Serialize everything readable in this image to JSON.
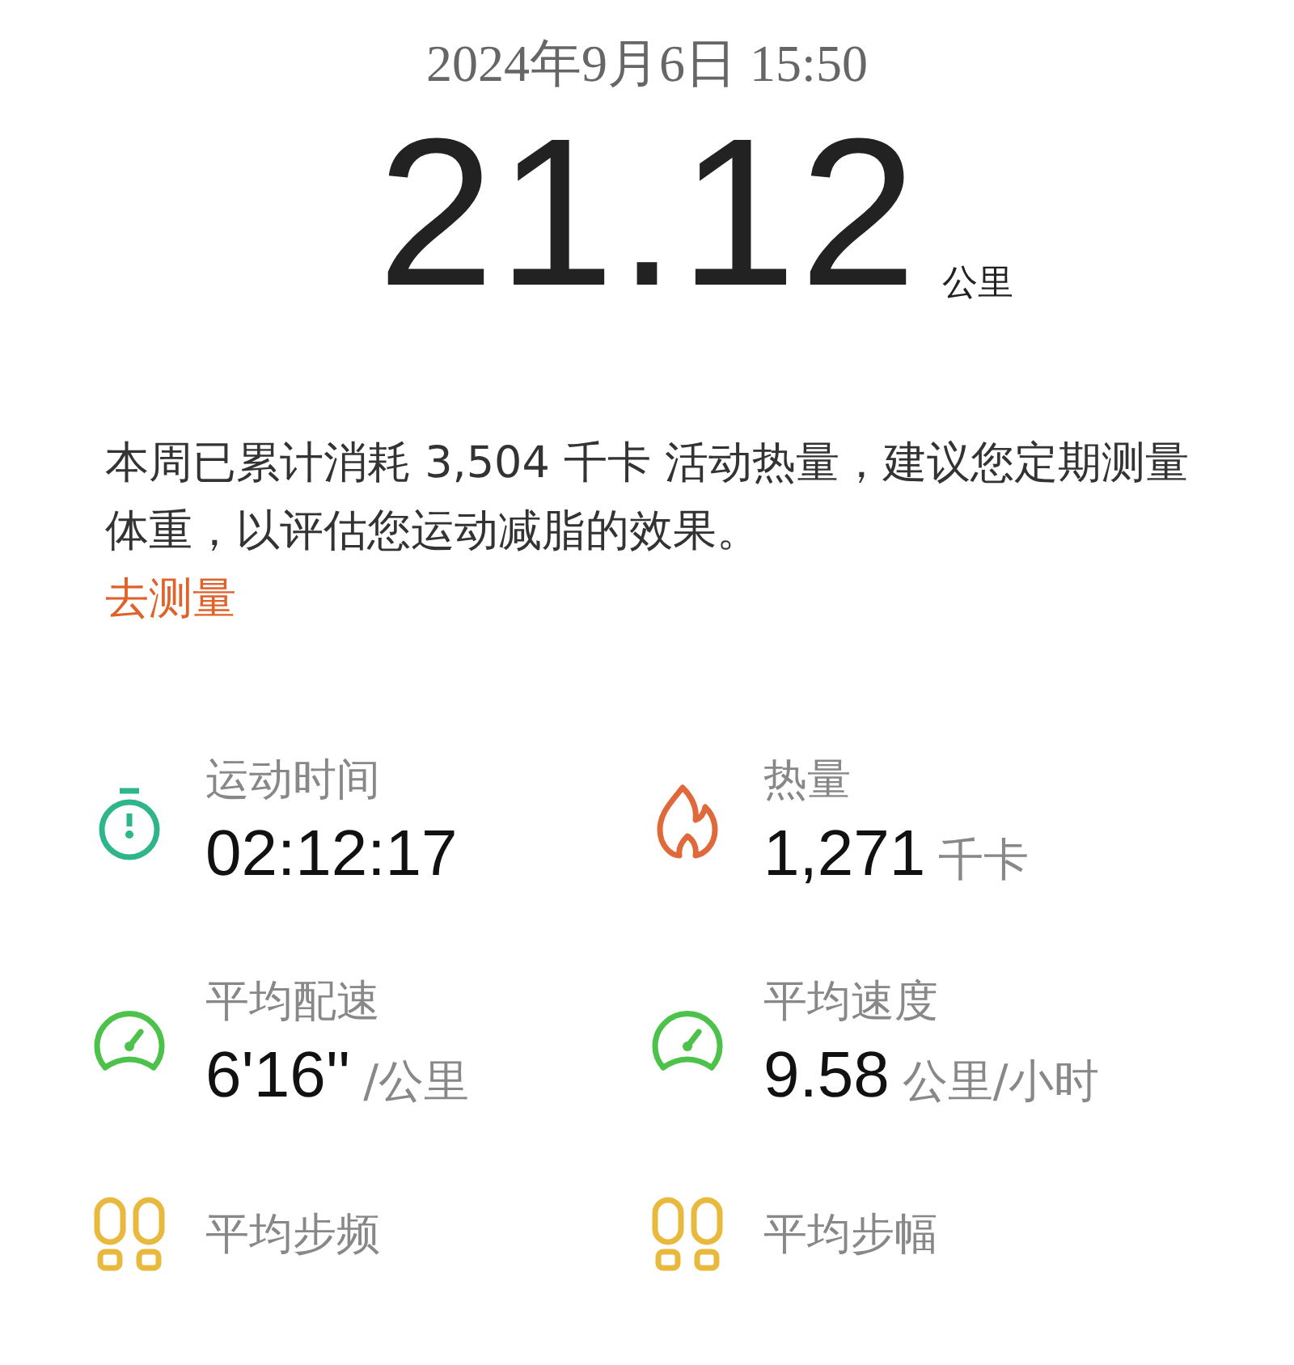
{
  "datetime": "2024年9月6日  15:50",
  "distance": {
    "value": "21.12",
    "unit": "公里"
  },
  "note": {
    "text": "本周已累计消耗 3,504 千卡 活动热量，建议您定期测量体重，以评估您运动减脂的效果。",
    "link": "去测量"
  },
  "stats": [
    {
      "kind": "stopwatch",
      "label": "运动时间",
      "value": "02:12:17"
    },
    {
      "kind": "flame",
      "label": "热量",
      "value": "1,271",
      "unit": "千卡"
    },
    {
      "kind": "gauge",
      "label": "平均配速",
      "value": "6'16''",
      "unit": "/公里"
    },
    {
      "kind": "gauge",
      "label": "平均速度",
      "value": "9.58",
      "unit": "公里/小时"
    },
    {
      "kind": "footprints",
      "label": "平均步频"
    },
    {
      "kind": "footprints",
      "label": "平均步幅"
    }
  ]
}
